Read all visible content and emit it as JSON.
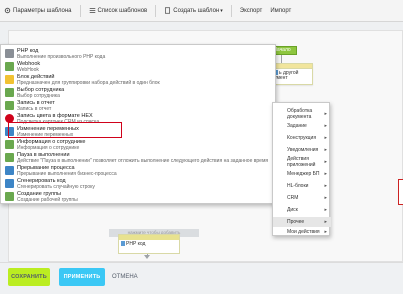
{
  "toolbar": {
    "params_label": "Параметры шаблона",
    "list_label": "Список шаблонов",
    "create_label": "Создать шаблон",
    "export_label": "Экспорт",
    "import_label": "Импорт"
  },
  "designer": {
    "start_label": "Начало",
    "card_top_text": "ь другой умент",
    "ghost_label": "нажмите чтобы добавить",
    "bottom_card_text": "PHP код"
  },
  "menu": {
    "items": [
      {
        "title": "PHP код",
        "subtitle": "Выполнение произвольного PHP кода",
        "icon": "php-code-icon",
        "color": "#8a8f96"
      },
      {
        "title": "Webhook",
        "subtitle": "WebHook",
        "icon": "webhook-icon",
        "color": "#6aa84f"
      },
      {
        "title": "Блок действий",
        "subtitle": "Предназначен для группировки набора действий в один блок",
        "icon": "action-block-icon",
        "color": "#f1c232"
      },
      {
        "title": "Выбор сотрудника",
        "subtitle": "Выбор сотрудника",
        "icon": "employee-select-icon",
        "color": "#6aa84f"
      },
      {
        "title": "Запись в отчет",
        "subtitle": "Запись в отчет",
        "icon": "report-record-icon",
        "color": "#6aa84f"
      },
      {
        "title": "Запись цвета в формате HEX",
        "subtitle": "Подсветка карточек CRM из списка",
        "icon": "hex-color-icon",
        "color": "#d0021b"
      },
      {
        "title": "Изменение переменных",
        "subtitle": "Изменение переменных",
        "icon": "variables-icon",
        "color": "#3d85c6"
      },
      {
        "title": "Информация о сотруднике",
        "subtitle": "Информация о сотруднике",
        "icon": "employee-info-icon",
        "color": "#6aa84f"
      },
      {
        "title": "Пауза в выполнении",
        "subtitle": "Действие \"Пауза в выполнении\" позволяет отложить выполнение следующего действия на заданное время",
        "icon": "pause-icon",
        "color": "#6aa84f"
      },
      {
        "title": "Прерывание процесса",
        "subtitle": "Прерывание выполнения бизнес-процесса",
        "icon": "process-stop-icon",
        "color": "#3d85c6"
      },
      {
        "title": "Сгенерировать код",
        "subtitle": "Сгенерировать случайную строку",
        "icon": "generate-code-icon",
        "color": "#3d85c6"
      },
      {
        "title": "Создание группы",
        "subtitle": "Создание рабочей группы",
        "icon": "group-create-icon",
        "color": "#6aa84f"
      }
    ]
  },
  "submenu": {
    "items": [
      {
        "label": "Обработка документа",
        "arrow": "▸"
      },
      {
        "label": "Задание",
        "arrow": "▸"
      },
      {
        "label": "Конструкция",
        "arrow": "▸"
      },
      {
        "label": "Уведомления",
        "arrow": "▸"
      },
      {
        "label": "Действия приложений",
        "arrow": "▸"
      },
      {
        "label": "Менеджер БП",
        "arrow": "▸"
      },
      {
        "label": "HL-блоки",
        "arrow": "▸"
      },
      {
        "label": "CRM",
        "arrow": "▸"
      },
      {
        "label": "Диск",
        "arrow": "▸"
      },
      {
        "label": "Прочее",
        "arrow": "▸"
      },
      {
        "label": "Мои действия",
        "arrow": "▸"
      }
    ],
    "active_index": 9
  },
  "footer": {
    "save_label": "СОХРАНИТЬ",
    "apply_label": "ПРИМЕНИТЬ",
    "cancel_label": "ОТМЕНА"
  },
  "colors": {
    "save": "#bbed21",
    "apply": "#3bc8f5",
    "highlight": "#d0021b",
    "start": "#8ec63f"
  }
}
